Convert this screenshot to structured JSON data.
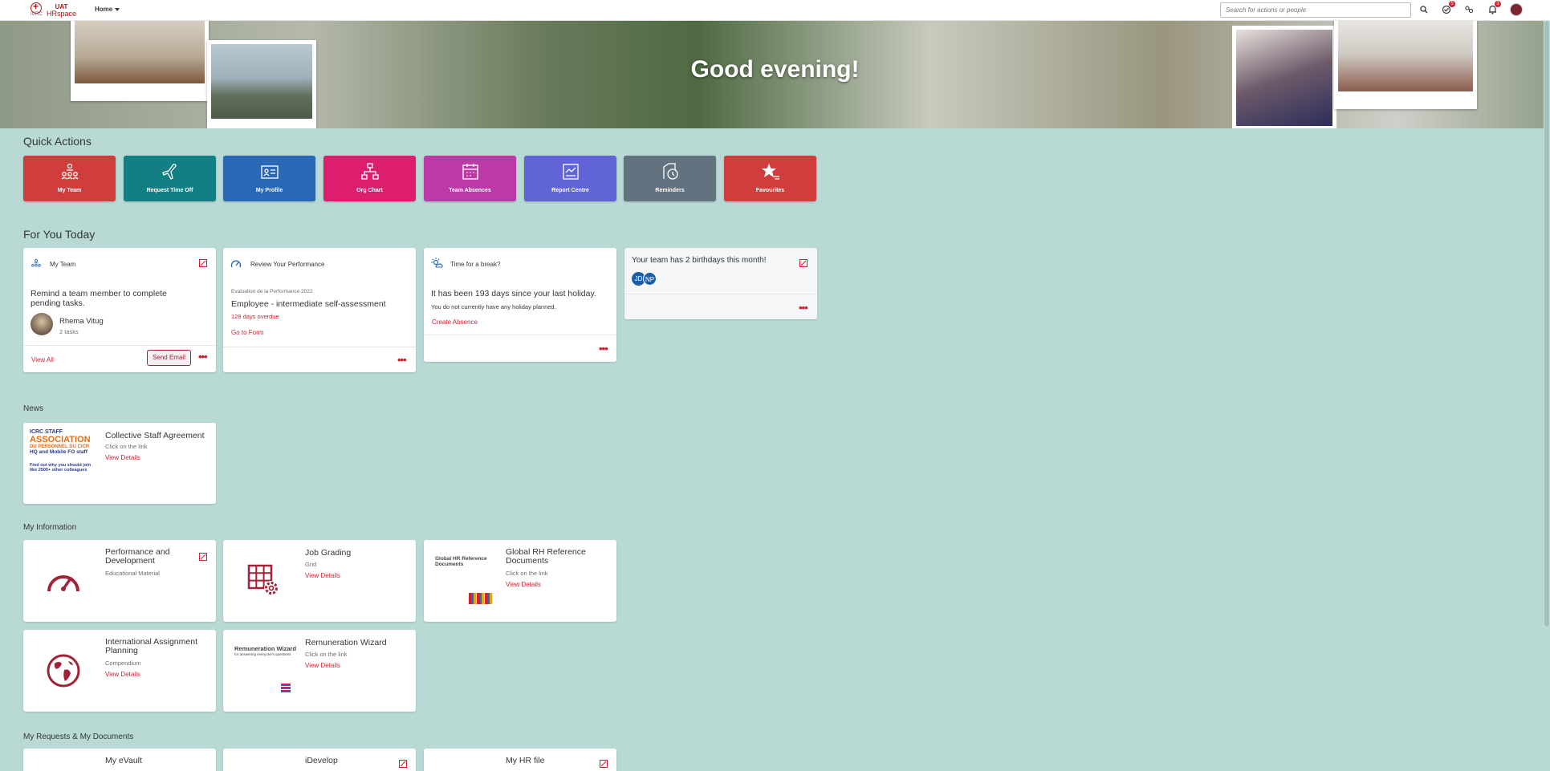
{
  "topbar": {
    "logo_text": "ICRC",
    "logo_uat": "UAT",
    "logo_hr": "HRspace",
    "home_menu": "Home",
    "search_placeholder": "Search for actions or people",
    "badge_todo": "5",
    "badge_notifications": "3"
  },
  "hero": {
    "greeting": "Good evening!"
  },
  "quick_actions": {
    "title": "Quick Actions",
    "tiles": [
      {
        "label": "My Team",
        "icon": "team-icon",
        "color": "#d03d3d"
      },
      {
        "label": "Request Time Off",
        "icon": "airplane-icon",
        "color": "#137e84"
      },
      {
        "label": "My Profile",
        "icon": "profile-card-icon",
        "color": "#2a67b5"
      },
      {
        "label": "Org Chart",
        "icon": "org-chart-icon",
        "color": "#dd1e6e"
      },
      {
        "label": "Team Absences",
        "icon": "calendar-icon",
        "color": "#bc3aa6"
      },
      {
        "label": "Report Centre",
        "icon": "report-icon",
        "color": "#6164d7"
      },
      {
        "label": "Reminders",
        "icon": "reminder-icon",
        "color": "#62727f"
      },
      {
        "label": "Favourites",
        "icon": "star-list-icon",
        "color": "#d03d3d"
      }
    ]
  },
  "for_you": {
    "title": "For You Today",
    "my_team": {
      "header": "My Team",
      "text": "Remind a team member to complete pending tasks.",
      "person_name": "Rhema Vitug",
      "person_tasks": "2 tasks",
      "view_all": "View All",
      "send_email": "Send Email"
    },
    "performance": {
      "header": "Review Your Performance",
      "subtitle": "Evaluation de la Performance 2022",
      "title": "Employee - intermediate self-assessment",
      "overdue": "128 days overdue",
      "link": "Go to Form"
    },
    "break": {
      "header": "Time for a break?",
      "title": "It has been 193 days since your last holiday.",
      "text": "You do not currently have any holiday planned.",
      "link": "Create Absence"
    },
    "birthdays": {
      "title": "Your team has 2 birthdays this month!",
      "initials": [
        "JD",
        "NP"
      ]
    }
  },
  "news": {
    "title": "News",
    "item": {
      "title": "Collective Staff Agreement",
      "subtitle": "Click on the link",
      "link": "View Details",
      "image_lines": [
        "ICRC STAFF",
        "ASSOCIATION",
        "DU PERSONNEL DU CICR",
        "HQ and Mobile FO staff",
        "Find out why you should join",
        "like 2500+ other colleagues"
      ]
    }
  },
  "my_information": {
    "title": "My Information",
    "cards": [
      {
        "title": "Performance and Development",
        "subtitle": "Educational Material",
        "link": ""
      },
      {
        "title": "Job Grading",
        "subtitle": "Grid",
        "link": "View Details"
      },
      {
        "title": "Global RH Reference Documents",
        "subtitle": "Click on the link",
        "link": "View Details",
        "image_text": "Global HR Reference Documents"
      },
      {
        "title": "International Assignment Planning",
        "subtitle": "Compendium",
        "link": "View Details"
      },
      {
        "title": "Remuneration Wizard",
        "subtitle": "Click on the link",
        "link": "View Details",
        "image_text": "Remuneration Wizard",
        "image_sub": "for answering everyone's questions"
      }
    ]
  },
  "requests": {
    "title": "My Requests & My Documents",
    "cards": [
      "My eVault",
      "iDevelop",
      "My HR file"
    ]
  },
  "colors": {
    "accent": "#d32030",
    "background": "#b8d9d4"
  }
}
